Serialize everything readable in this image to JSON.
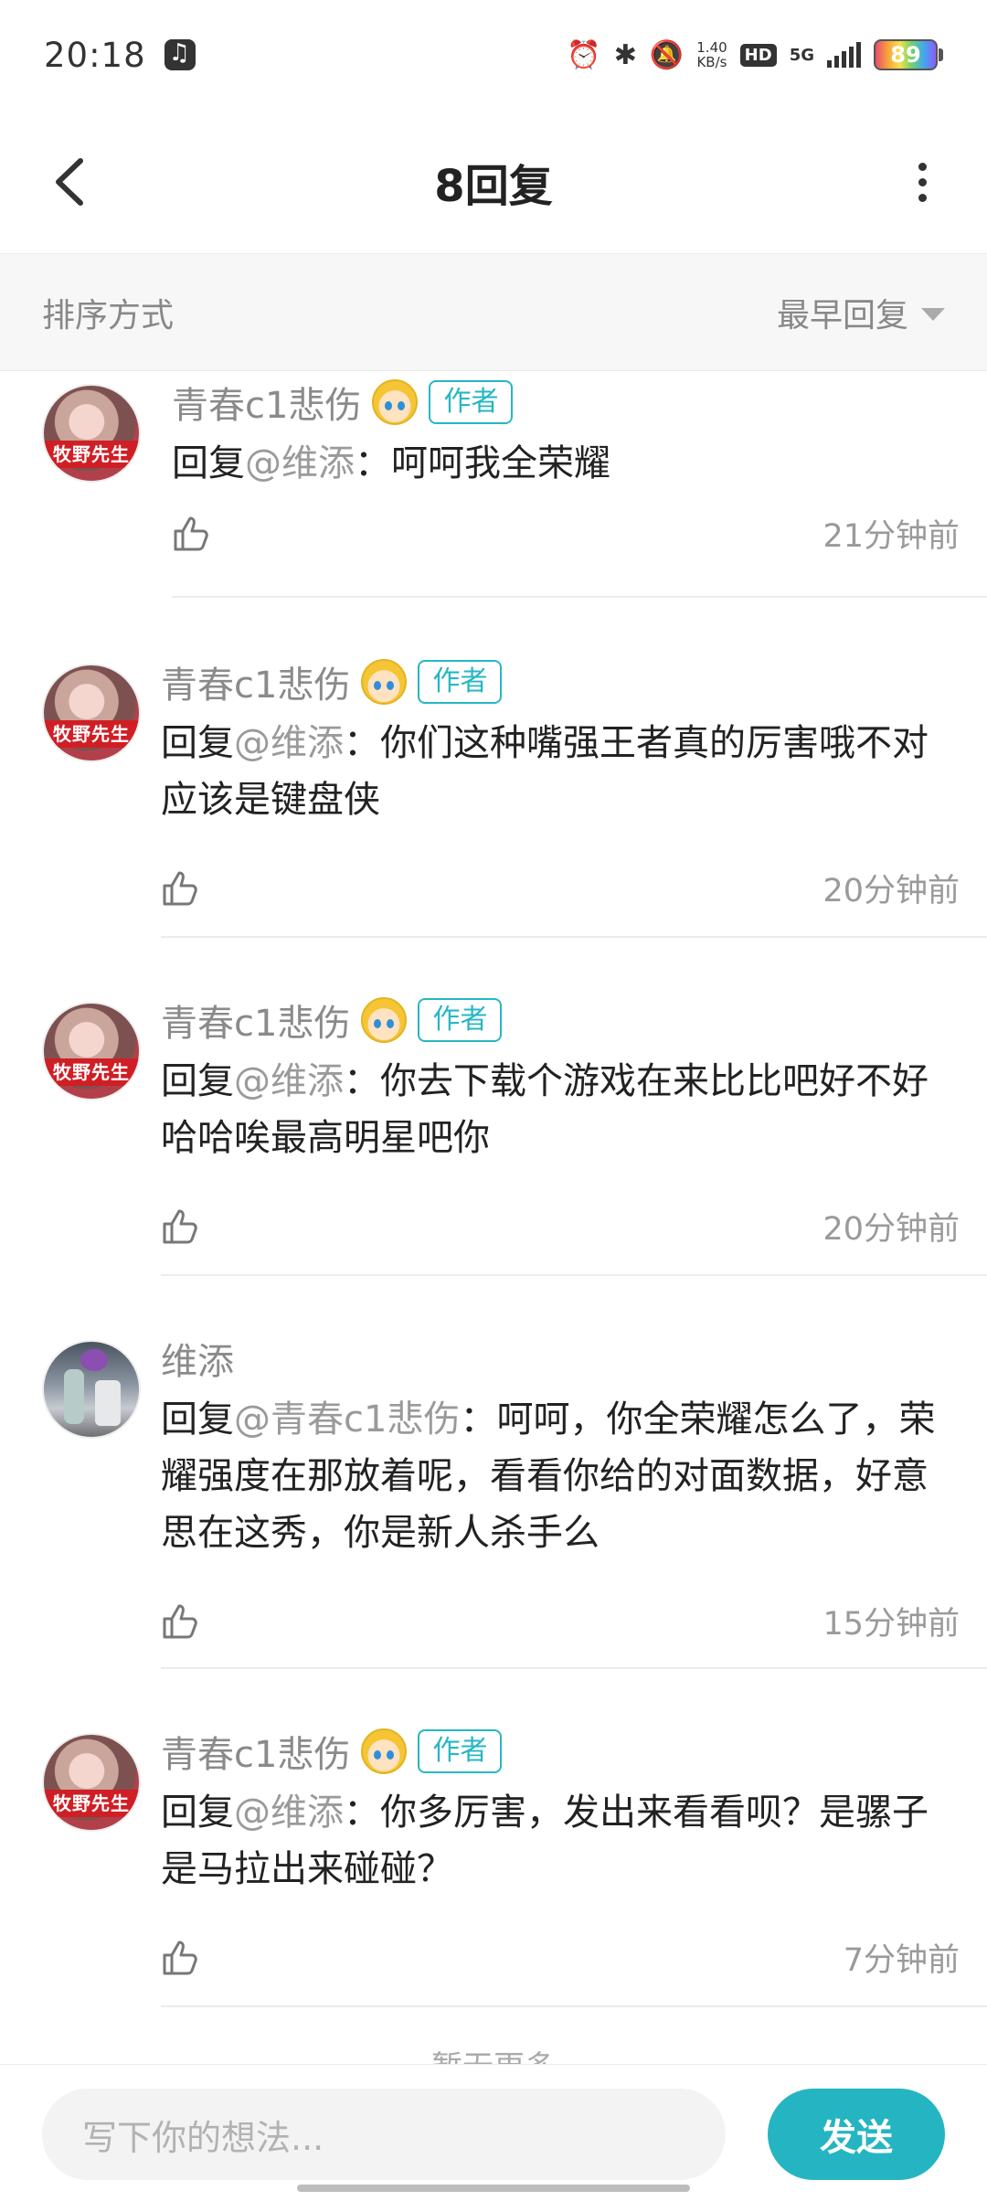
{
  "status_bar": {
    "time": "20:18",
    "speed_value": "1.40",
    "speed_unit": "KB/s",
    "hd": "HD",
    "network": "5G",
    "battery": "89"
  },
  "header": {
    "title": "8回复"
  },
  "sort": {
    "label": "排序方式",
    "value": "最早回复"
  },
  "comments": [
    {
      "name": "青春c1悲伤",
      "tag": "作者",
      "reply_prefix": "回复",
      "reply_to": "@维添",
      "text": "：呵呵我全荣耀",
      "time": "21分钟前",
      "avatar_text": "牧野先生"
    },
    {
      "name": "青春c1悲伤",
      "tag": "作者",
      "reply_prefix": "回复",
      "reply_to": "@维添",
      "text": "：你们这种嘴强王者真的厉害哦不对应该是键盘侠",
      "time": "20分钟前",
      "avatar_text": "牧野先生"
    },
    {
      "name": "青春c1悲伤",
      "tag": "作者",
      "reply_prefix": "回复",
      "reply_to": "@维添",
      "text": "：你去下载个游戏在来比比吧好不好哈哈唉最高明星吧你",
      "time": "20分钟前",
      "avatar_text": "牧野先生"
    },
    {
      "name": "维添",
      "tag": "",
      "reply_prefix": "回复",
      "reply_to": "@青春c1悲伤",
      "text": "：呵呵，你全荣耀怎么了，荣耀强度在那放着呢，看看你给的对面数据，好意思在这秀，你是新人杀手么",
      "time": "15分钟前",
      "avatar_text": ""
    },
    {
      "name": "青春c1悲伤",
      "tag": "作者",
      "reply_prefix": "回复",
      "reply_to": "@维添",
      "text": "：你多厉害，发出来看看呗？是骡子是马拉出来碰碰？",
      "time": "7分钟前",
      "avatar_text": "牧野先生"
    }
  ],
  "footer_note": "暂无更多",
  "composer": {
    "placeholder": "写下你的想法...",
    "send_label": "发送"
  }
}
